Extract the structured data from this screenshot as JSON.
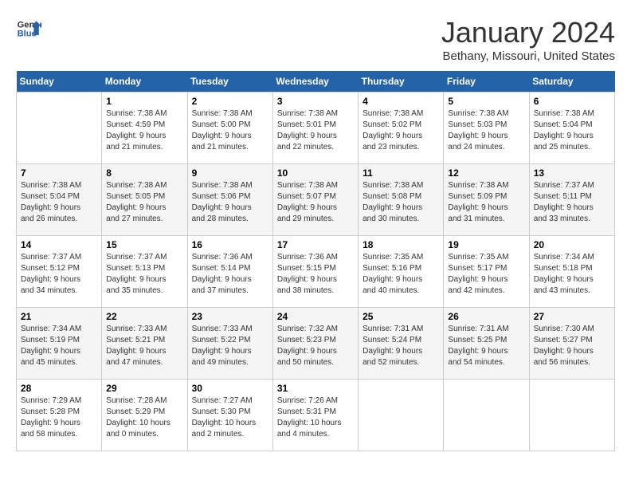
{
  "header": {
    "logo_line1": "General",
    "logo_line2": "Blue",
    "month": "January 2024",
    "location": "Bethany, Missouri, United States"
  },
  "days_of_week": [
    "Sunday",
    "Monday",
    "Tuesday",
    "Wednesday",
    "Thursday",
    "Friday",
    "Saturday"
  ],
  "weeks": [
    [
      {
        "day": "",
        "info": ""
      },
      {
        "day": "1",
        "info": "Sunrise: 7:38 AM\nSunset: 4:59 PM\nDaylight: 9 hours\nand 21 minutes."
      },
      {
        "day": "2",
        "info": "Sunrise: 7:38 AM\nSunset: 5:00 PM\nDaylight: 9 hours\nand 21 minutes."
      },
      {
        "day": "3",
        "info": "Sunrise: 7:38 AM\nSunset: 5:01 PM\nDaylight: 9 hours\nand 22 minutes."
      },
      {
        "day": "4",
        "info": "Sunrise: 7:38 AM\nSunset: 5:02 PM\nDaylight: 9 hours\nand 23 minutes."
      },
      {
        "day": "5",
        "info": "Sunrise: 7:38 AM\nSunset: 5:03 PM\nDaylight: 9 hours\nand 24 minutes."
      },
      {
        "day": "6",
        "info": "Sunrise: 7:38 AM\nSunset: 5:04 PM\nDaylight: 9 hours\nand 25 minutes."
      }
    ],
    [
      {
        "day": "7",
        "info": "Sunrise: 7:38 AM\nSunset: 5:04 PM\nDaylight: 9 hours\nand 26 minutes."
      },
      {
        "day": "8",
        "info": "Sunrise: 7:38 AM\nSunset: 5:05 PM\nDaylight: 9 hours\nand 27 minutes."
      },
      {
        "day": "9",
        "info": "Sunrise: 7:38 AM\nSunset: 5:06 PM\nDaylight: 9 hours\nand 28 minutes."
      },
      {
        "day": "10",
        "info": "Sunrise: 7:38 AM\nSunset: 5:07 PM\nDaylight: 9 hours\nand 29 minutes."
      },
      {
        "day": "11",
        "info": "Sunrise: 7:38 AM\nSunset: 5:08 PM\nDaylight: 9 hours\nand 30 minutes."
      },
      {
        "day": "12",
        "info": "Sunrise: 7:38 AM\nSunset: 5:09 PM\nDaylight: 9 hours\nand 31 minutes."
      },
      {
        "day": "13",
        "info": "Sunrise: 7:37 AM\nSunset: 5:11 PM\nDaylight: 9 hours\nand 33 minutes."
      }
    ],
    [
      {
        "day": "14",
        "info": "Sunrise: 7:37 AM\nSunset: 5:12 PM\nDaylight: 9 hours\nand 34 minutes."
      },
      {
        "day": "15",
        "info": "Sunrise: 7:37 AM\nSunset: 5:13 PM\nDaylight: 9 hours\nand 35 minutes."
      },
      {
        "day": "16",
        "info": "Sunrise: 7:36 AM\nSunset: 5:14 PM\nDaylight: 9 hours\nand 37 minutes."
      },
      {
        "day": "17",
        "info": "Sunrise: 7:36 AM\nSunset: 5:15 PM\nDaylight: 9 hours\nand 38 minutes."
      },
      {
        "day": "18",
        "info": "Sunrise: 7:35 AM\nSunset: 5:16 PM\nDaylight: 9 hours\nand 40 minutes."
      },
      {
        "day": "19",
        "info": "Sunrise: 7:35 AM\nSunset: 5:17 PM\nDaylight: 9 hours\nand 42 minutes."
      },
      {
        "day": "20",
        "info": "Sunrise: 7:34 AM\nSunset: 5:18 PM\nDaylight: 9 hours\nand 43 minutes."
      }
    ],
    [
      {
        "day": "21",
        "info": "Sunrise: 7:34 AM\nSunset: 5:19 PM\nDaylight: 9 hours\nand 45 minutes."
      },
      {
        "day": "22",
        "info": "Sunrise: 7:33 AM\nSunset: 5:21 PM\nDaylight: 9 hours\nand 47 minutes."
      },
      {
        "day": "23",
        "info": "Sunrise: 7:33 AM\nSunset: 5:22 PM\nDaylight: 9 hours\nand 49 minutes."
      },
      {
        "day": "24",
        "info": "Sunrise: 7:32 AM\nSunset: 5:23 PM\nDaylight: 9 hours\nand 50 minutes."
      },
      {
        "day": "25",
        "info": "Sunrise: 7:31 AM\nSunset: 5:24 PM\nDaylight: 9 hours\nand 52 minutes."
      },
      {
        "day": "26",
        "info": "Sunrise: 7:31 AM\nSunset: 5:25 PM\nDaylight: 9 hours\nand 54 minutes."
      },
      {
        "day": "27",
        "info": "Sunrise: 7:30 AM\nSunset: 5:27 PM\nDaylight: 9 hours\nand 56 minutes."
      }
    ],
    [
      {
        "day": "28",
        "info": "Sunrise: 7:29 AM\nSunset: 5:28 PM\nDaylight: 9 hours\nand 58 minutes."
      },
      {
        "day": "29",
        "info": "Sunrise: 7:28 AM\nSunset: 5:29 PM\nDaylight: 10 hours\nand 0 minutes."
      },
      {
        "day": "30",
        "info": "Sunrise: 7:27 AM\nSunset: 5:30 PM\nDaylight: 10 hours\nand 2 minutes."
      },
      {
        "day": "31",
        "info": "Sunrise: 7:26 AM\nSunset: 5:31 PM\nDaylight: 10 hours\nand 4 minutes."
      },
      {
        "day": "",
        "info": ""
      },
      {
        "day": "",
        "info": ""
      },
      {
        "day": "",
        "info": ""
      }
    ]
  ]
}
